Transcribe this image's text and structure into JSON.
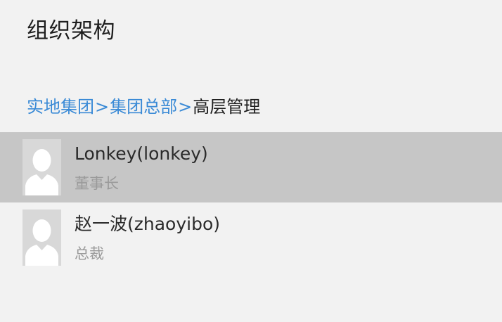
{
  "header": {
    "title": "组织架构"
  },
  "breadcrumb": {
    "items": [
      {
        "label": "实地集团",
        "link": true
      },
      {
        "label": "集团总部",
        "link": true
      },
      {
        "label": "高层管理",
        "link": false
      }
    ],
    "separator": ">"
  },
  "members": [
    {
      "name": "Lonkey(lonkey)",
      "title": "董事长",
      "selected": true,
      "avatar": "default-person-avatar"
    },
    {
      "name": "赵一波(zhaoyibo)",
      "title": "总裁",
      "selected": false,
      "avatar": "default-person-avatar"
    }
  ],
  "colors": {
    "background": "#f2f2f2",
    "link": "#3a8ad6",
    "selected_row": "#c6c6c6",
    "secondary_text": "#9a9a9a"
  }
}
